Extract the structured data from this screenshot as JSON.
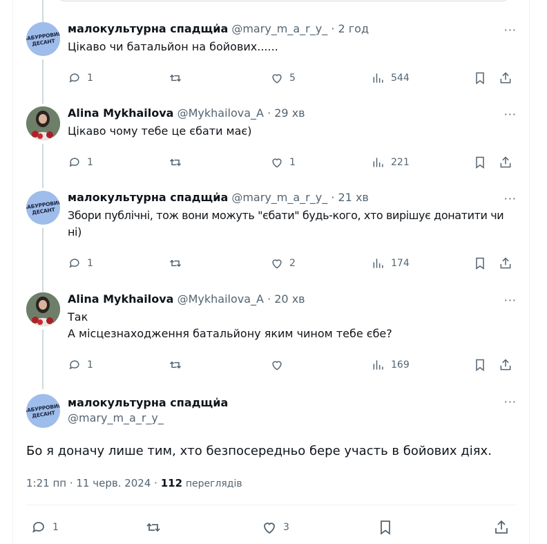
{
  "thread": [
    {
      "author_name": "малокультурна спадщи҆а",
      "author_handle": "@mary_m_a_r_y_",
      "sep": "·",
      "time": "2 год",
      "text": "Цікаво чи батальйон на бойових......",
      "replies": "1",
      "retweets": "",
      "likes": "5",
      "views": "544",
      "avatar": "mary-avatar"
    },
    {
      "author_name": "Alina Mykhailova",
      "author_handle": "@Mykhailova_A",
      "sep": "·",
      "time": "29 хв",
      "text": "Цікаво чому тебе це єбати має)",
      "replies": "1",
      "retweets": "",
      "likes": "1",
      "views": "221",
      "avatar": "alina-avatar"
    },
    {
      "author_name": "малокультурна спадщи҆а",
      "author_handle": "@mary_m_a_r_y_",
      "sep": "·",
      "time": "21 хв",
      "text": "Збори публічні, тож вони можуть \"єбати\" будь-кого, хто вирішує донатити чи ні)",
      "replies": "1",
      "retweets": "",
      "likes": "2",
      "views": "174",
      "avatar": "mary-avatar"
    },
    {
      "author_name": "Alina Mykhailova",
      "author_handle": "@Mykhailova_A",
      "sep": "·",
      "time": "20 хв",
      "text_line1": "Так",
      "text_line2": "А місцезнаходження батальйону яким чином тебе єбе?",
      "replies": "1",
      "retweets": "",
      "likes": "",
      "views": "169",
      "avatar": "alina-avatar"
    }
  ],
  "main": {
    "author_name": "малокультурна спадщи҆а",
    "author_handle": "@mary_m_a_r_y_",
    "text": "Бо я доначу лише тим, хто безпосередньо бере участь в бойових діях.",
    "time": "1:21 пп · 11 черв. 2024 ·",
    "views_count": "112",
    "views_label": "переглядів",
    "replies": "1",
    "likes": "3"
  },
  "more_label": "···",
  "avatar_logo_line1": "БАБУРРОВИЙ",
  "avatar_logo_line2": "ДЕСАНТ",
  "colors": {
    "text": "#0f1419",
    "muted": "#536471",
    "line": "#cfd9de",
    "avatar_blue": "#9fbdea"
  },
  "icons": [
    "reply-icon",
    "retweet-icon",
    "like-icon",
    "views-icon",
    "bookmark-icon",
    "share-icon",
    "more-icon"
  ]
}
